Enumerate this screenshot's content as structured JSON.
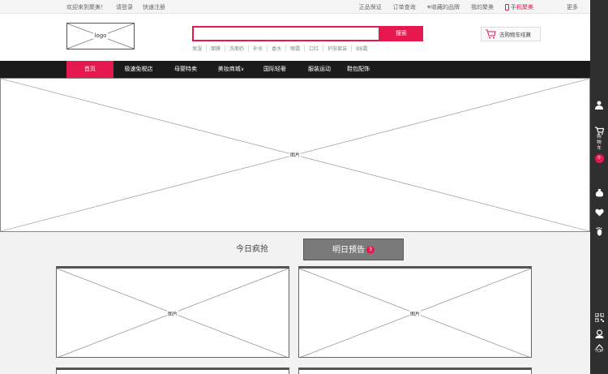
{
  "topbar": {
    "welcome": "欢迎来到聚美！",
    "login": "请登录",
    "register": "快速注册",
    "right_links": [
      "正品保证",
      "订单查询",
      "收藏的品牌",
      "我的聚美"
    ],
    "mobile": "手机聚美",
    "more": "更多"
  },
  "header": {
    "logo": "logo",
    "search_button": "搜索",
    "search_placeholder": "",
    "hot_words": [
      "保湿",
      "面膜",
      "洗面奶",
      "补水",
      "香水",
      "眼霜",
      "口红",
      "护肤套装",
      "BB霜"
    ],
    "cart": "去购物车结算"
  },
  "nav": {
    "items": [
      "首页",
      "极速免税店",
      "母婴特卖",
      "美妆商城",
      "国际轻奢",
      "服装运动",
      "鞋包配饰"
    ]
  },
  "banner": {
    "label": "图片"
  },
  "tabs": {
    "today": "今日疯抢",
    "tomorrow": "明日预告",
    "badge": "3"
  },
  "cards": {
    "label": "图片"
  },
  "sidebar": {
    "cart_label": [
      "购",
      "物",
      "车"
    ],
    "cart_count": "0",
    "top": "TOP"
  },
  "colors": {
    "accent": "#e5194f",
    "nav_bg": "#1b1b1b",
    "sidebar_bg": "#2f2f2f"
  }
}
